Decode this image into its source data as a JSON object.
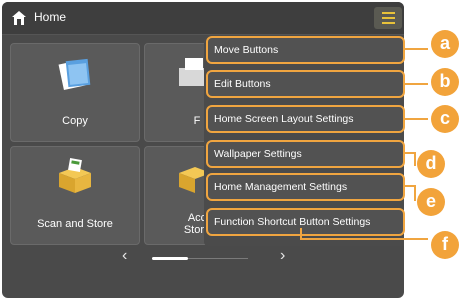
{
  "header": {
    "title": "Home"
  },
  "tiles": [
    {
      "label": "Copy",
      "icon": "copy-icon"
    },
    {
      "label": "F",
      "icon": "fax-icon"
    },
    {
      "label": "Scan and Store",
      "icon": "scan-and-store-icon"
    },
    {
      "label_line1": "Acc",
      "label_line2": "Store",
      "icon": "access-stored-files-icon"
    }
  ],
  "menu": {
    "items": [
      {
        "label": "Move Buttons",
        "callout": "a"
      },
      {
        "label": "Edit Buttons",
        "callout": "b"
      },
      {
        "label": "Home Screen Layout Settings",
        "callout": "c"
      },
      {
        "label": "Wallpaper Settings",
        "callout": "d"
      },
      {
        "label": "Home Management Settings",
        "callout": "e"
      },
      {
        "label": "Function Shortcut Button Settings",
        "callout": "f"
      }
    ]
  },
  "nav": {
    "prev": "‹",
    "next": "›"
  },
  "colors": {
    "accent": "#f2a33a",
    "menu_icon": "#e8c23a",
    "background": "#4a4a4a"
  }
}
